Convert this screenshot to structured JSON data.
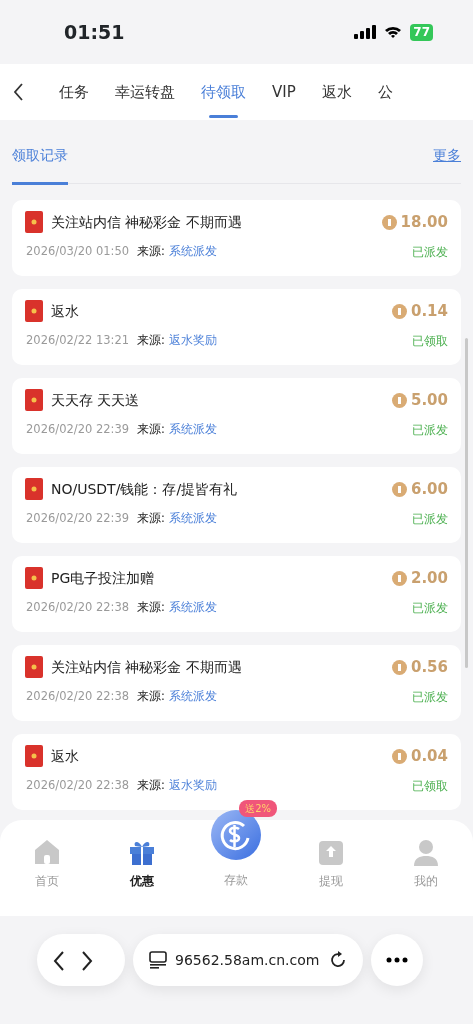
{
  "status_bar": {
    "time": "01:51",
    "battery": "77"
  },
  "tabs": [
    {
      "label": "任务",
      "selected": false
    },
    {
      "label": "幸运转盘",
      "selected": false
    },
    {
      "label": "待领取",
      "selected": true
    },
    {
      "label": "VIP",
      "selected": false
    },
    {
      "label": "返水",
      "selected": false
    },
    {
      "label": "公",
      "selected": false
    }
  ],
  "section": {
    "tab": {
      "label": "领取记录",
      "selected": true
    },
    "more": "更多"
  },
  "records": [
    {
      "title": "关注站内信 神秘彩金 不期而遇",
      "amount": "18.00",
      "time": "2026/03/20 01:50",
      "source_label": "来源:",
      "source": "系统派发",
      "status": "已派发"
    },
    {
      "title": "返水",
      "amount": "0.14",
      "time": "2026/02/22 13:21",
      "source_label": "来源:",
      "source": "返水奖励",
      "status": "已领取"
    },
    {
      "title": "天天存 天天送",
      "amount": "5.00",
      "time": "2026/02/20 22:39",
      "source_label": "来源:",
      "source": "系统派发",
      "status": "已派发"
    },
    {
      "title": "NO/USDT/钱能：存/提皆有礼",
      "amount": "6.00",
      "time": "2026/02/20 22:39",
      "source_label": "来源:",
      "source": "系统派发",
      "status": "已派发"
    },
    {
      "title": "PG电子投注加赠",
      "amount": "2.00",
      "time": "2026/02/20 22:38",
      "source_label": "来源:",
      "source": "系统派发",
      "status": "已派发"
    },
    {
      "title": "关注站内信 神秘彩金 不期而遇",
      "amount": "0.56",
      "time": "2026/02/20 22:38",
      "source_label": "来源:",
      "source": "系统派发",
      "status": "已派发"
    },
    {
      "title": "返水",
      "amount": "0.04",
      "time": "2026/02/20 22:38",
      "source_label": "来源:",
      "source": "返水奖励",
      "status": "已领取"
    }
  ],
  "bottom_nav": [
    {
      "kind": "home",
      "label": "首页",
      "selected": false
    },
    {
      "kind": "gift",
      "label": "优惠",
      "selected": true
    },
    {
      "kind": "deposit",
      "label": "存款",
      "selected": false,
      "badge": "送2%"
    },
    {
      "kind": "withdraw",
      "label": "提现",
      "selected": false
    },
    {
      "kind": "profile",
      "label": "我的",
      "selected": false
    }
  ],
  "browser": {
    "url": "96562.58am.cn.com"
  }
}
